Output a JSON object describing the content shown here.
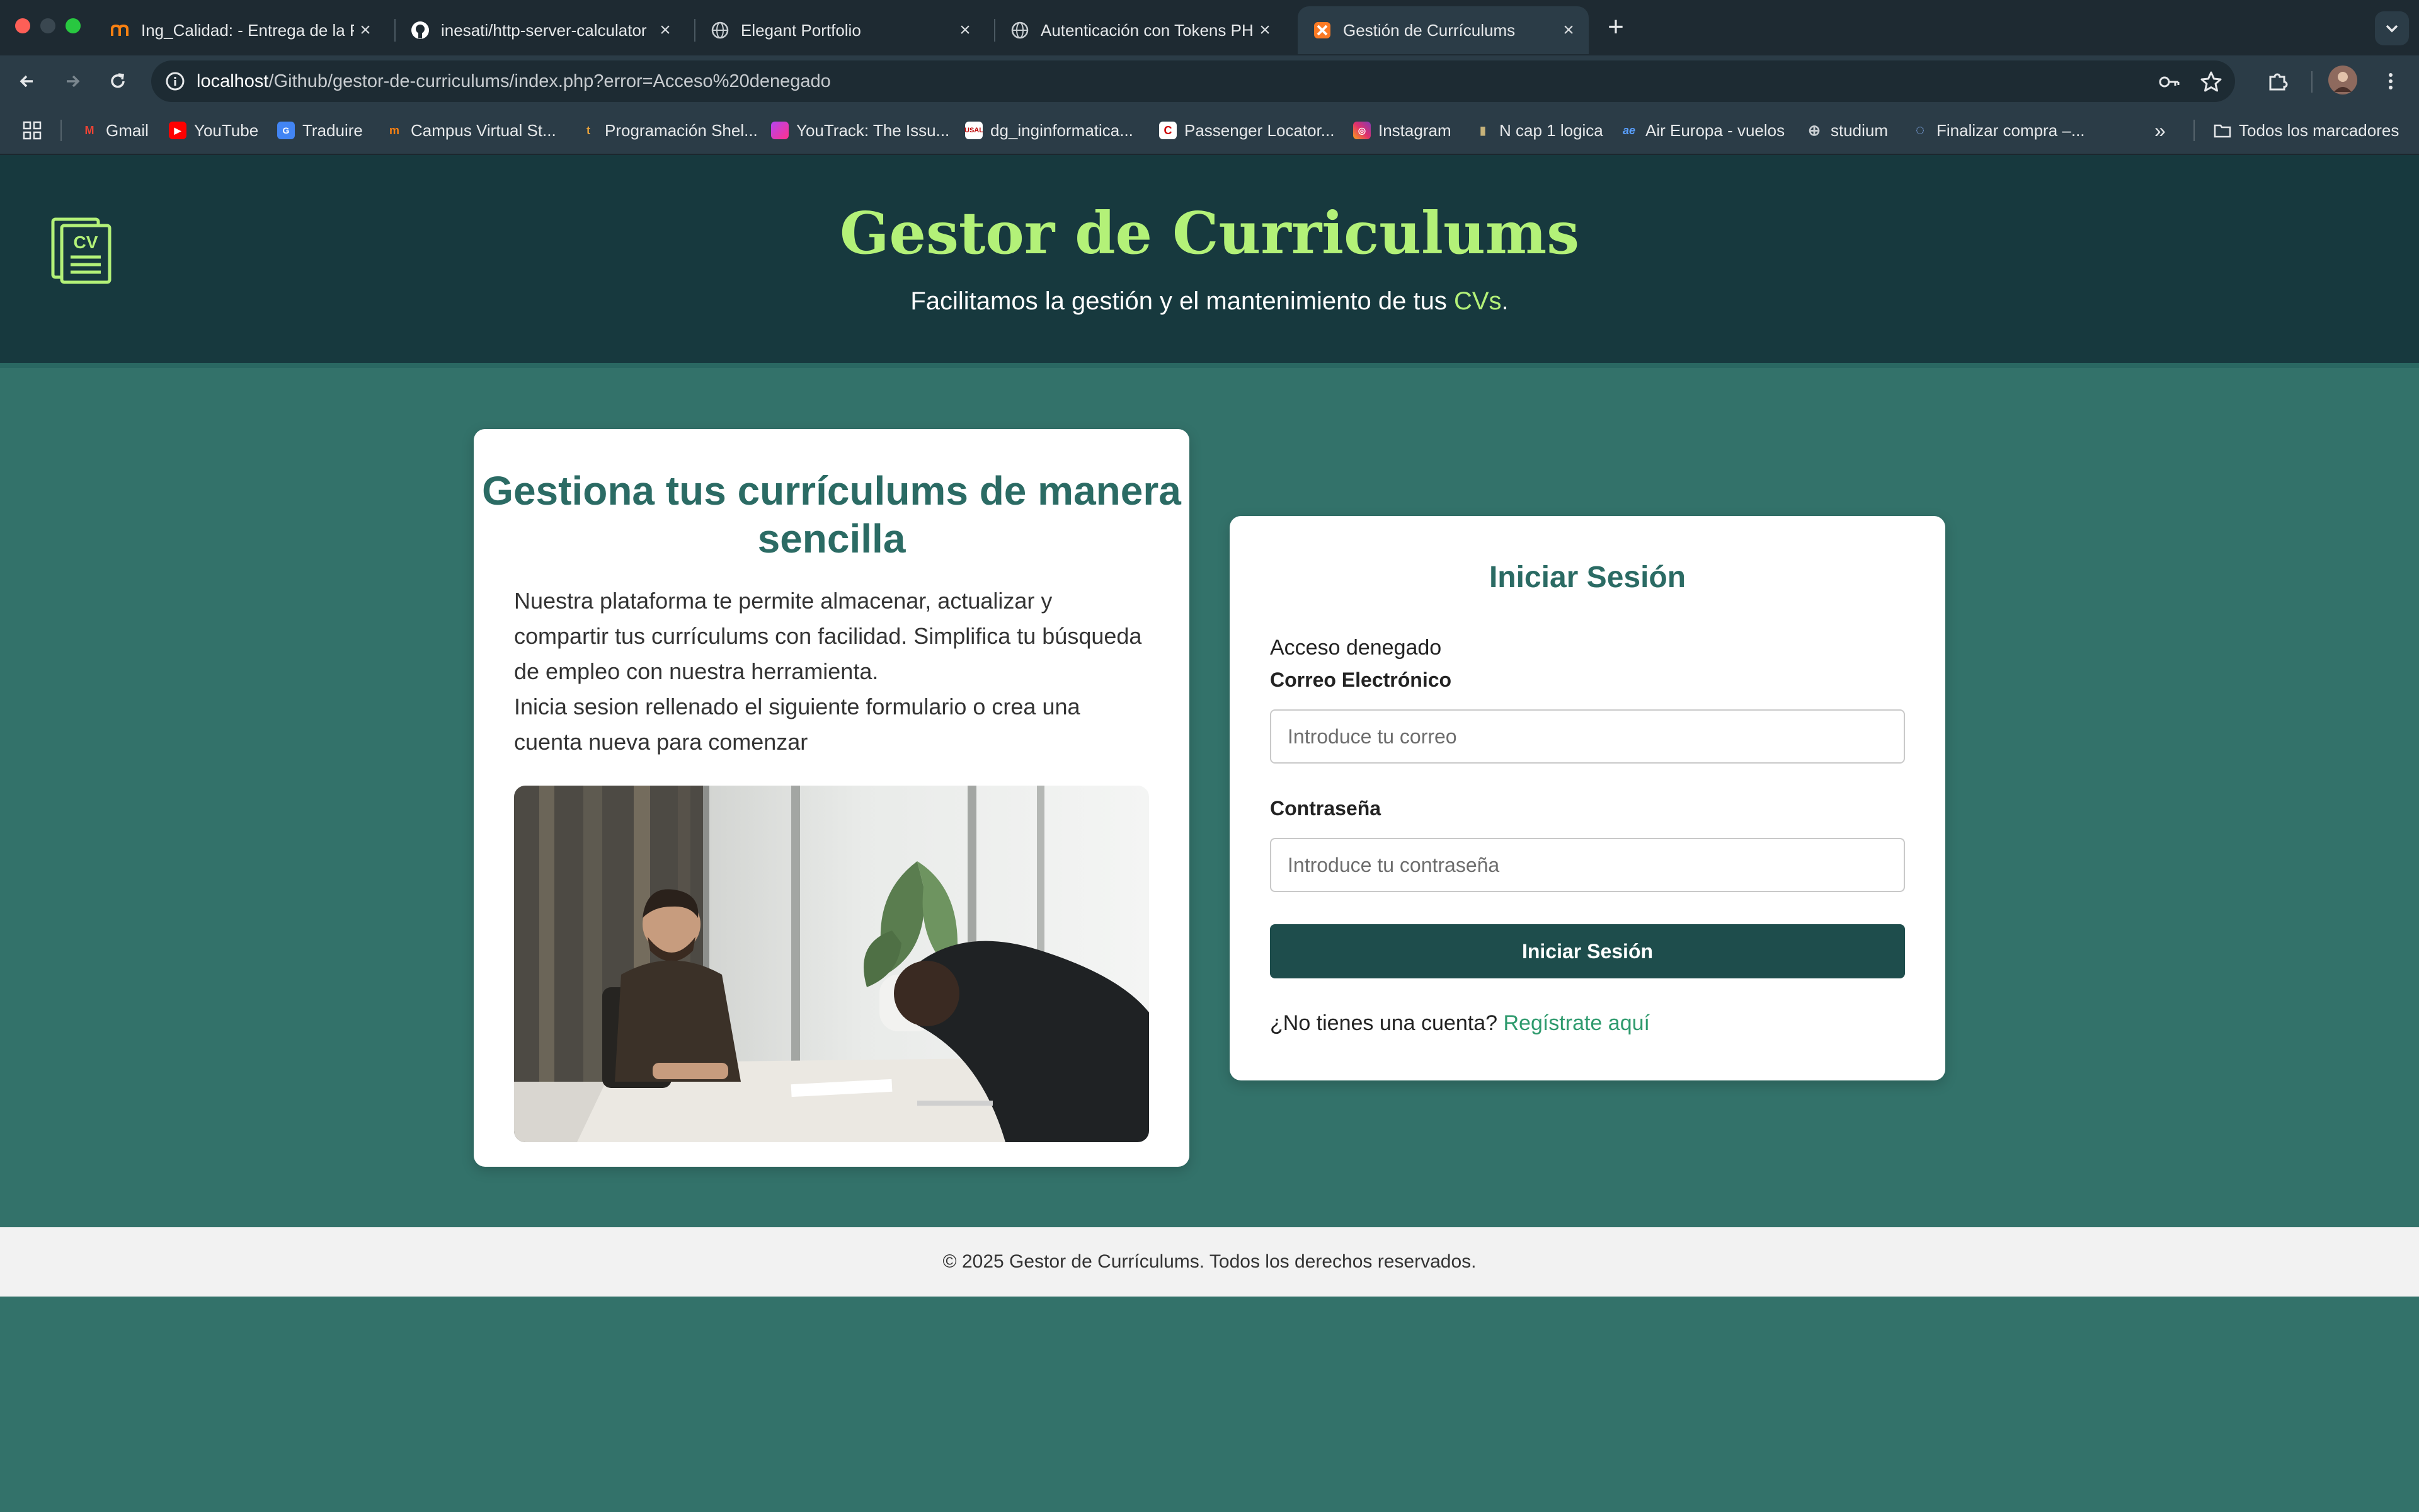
{
  "browser": {
    "tabs": [
      {
        "title": "Ing_Calidad: - Entrega de la P",
        "icon": "moodle-icon"
      },
      {
        "title": "inesati/http-server-calculator",
        "icon": "github-icon"
      },
      {
        "title": "Elegant Portfolio",
        "icon": "globe-icon"
      },
      {
        "title": "Autenticación con Tokens PHP",
        "icon": "globe-icon"
      },
      {
        "title": "Gestión de Currículums",
        "icon": "xampp-icon",
        "active": true
      }
    ],
    "address": {
      "host": "localhost",
      "path": "/Github/gestor-de-curriculums/index.php?error=Acceso%20denegado"
    },
    "bookmarks": [
      {
        "label": "Gmail",
        "icon": "gmail-icon"
      },
      {
        "label": "YouTube",
        "icon": "youtube-icon"
      },
      {
        "label": "Traduire",
        "icon": "translate-icon"
      },
      {
        "label": "Campus Virtual St...",
        "icon": "moodle-icon"
      },
      {
        "label": "Programación Shel...",
        "icon": "bookmark-icon"
      },
      {
        "label": "YouTrack: The Issu...",
        "icon": "youtrack-icon"
      },
      {
        "label": "dg_inginformatica...",
        "icon": "bookmark-icon"
      },
      {
        "label": "Passenger Locator...",
        "icon": "bookmark-icon"
      },
      {
        "label": "Instagram",
        "icon": "instagram-icon"
      },
      {
        "label": "N cap 1 logica",
        "icon": "bookmark-icon"
      },
      {
        "label": "Air Europa - vuelos",
        "icon": "aireuropa-icon"
      },
      {
        "label": "studium",
        "icon": "globe-icon"
      },
      {
        "label": "Finalizar compra –...",
        "icon": "loading-icon"
      }
    ],
    "more_bookmarks": "»",
    "all_bookmarks": "Todos los marcadores"
  },
  "header": {
    "title": "Gestor de Curriculums",
    "subtitle_pre": "Facilitamos la gestión y el mantenimiento de tus ",
    "subtitle_hl": "CVs",
    "subtitle_post": ".",
    "logo_text": "CV"
  },
  "intro": {
    "heading": "Gestiona tus currículums de manera sencilla",
    "paragraph1": "Nuestra plataforma te permite almacenar, actualizar y compartir tus currículums con facilidad. Simplifica tu búsqueda de empleo con nuestra herramienta.",
    "paragraph2": "Inicia sesion rellenado el siguiente formulario o crea una cuenta nueva para comenzar"
  },
  "login": {
    "title": "Iniciar Sesión",
    "error": "Acceso denegado",
    "email_label": "Correo Electrónico",
    "email_placeholder": "Introduce tu correo",
    "password_label": "Contraseña",
    "password_placeholder": "Introduce tu contraseña",
    "submit": "Iniciar Sesión",
    "register_prompt": "¿No tienes una cuenta?",
    "register_link": "Regístrate aquí"
  },
  "footer": {
    "text": "© 2025 Gestor de Currículums. Todos los derechos reservados."
  },
  "colors": {
    "header_bg": "#17393e",
    "page_bg": "#33726a",
    "accent": "#b3f178",
    "heading": "#2b6b64",
    "button": "#1e4d4c",
    "link": "#2e9a6d"
  }
}
